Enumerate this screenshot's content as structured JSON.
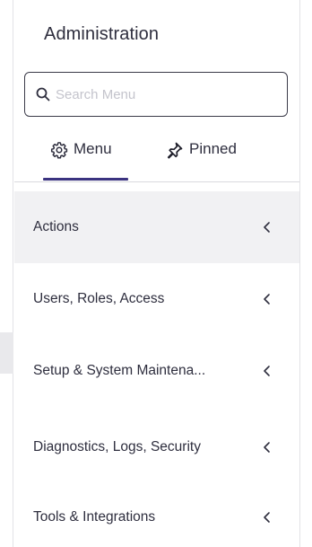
{
  "panel": {
    "title": "Administration"
  },
  "search": {
    "placeholder": "Search Menu",
    "value": ""
  },
  "tabs": [
    {
      "label": "Menu",
      "icon": "gear-icon",
      "selected": true
    },
    {
      "label": "Pinned",
      "icon": "pin-icon",
      "selected": false
    }
  ],
  "menu": {
    "items": [
      {
        "label": "Actions",
        "icon": "chevron-left-icon",
        "active": true
      },
      {
        "label": "Users, Roles, Access",
        "icon": "chevron-left-icon",
        "active": false
      },
      {
        "label": "Setup & System Maintena...",
        "icon": "chevron-left-icon",
        "active": false
      },
      {
        "label": "Diagnostics, Logs, Security",
        "icon": "chevron-left-icon",
        "active": false
      },
      {
        "label": "Tools & Integrations",
        "icon": "chevron-left-icon",
        "active": false
      }
    ]
  },
  "colors": {
    "accent": "#3b3380",
    "text": "#2e2e3e",
    "active_row": "#f1f1f3",
    "placeholder": "#c4c4cc"
  }
}
